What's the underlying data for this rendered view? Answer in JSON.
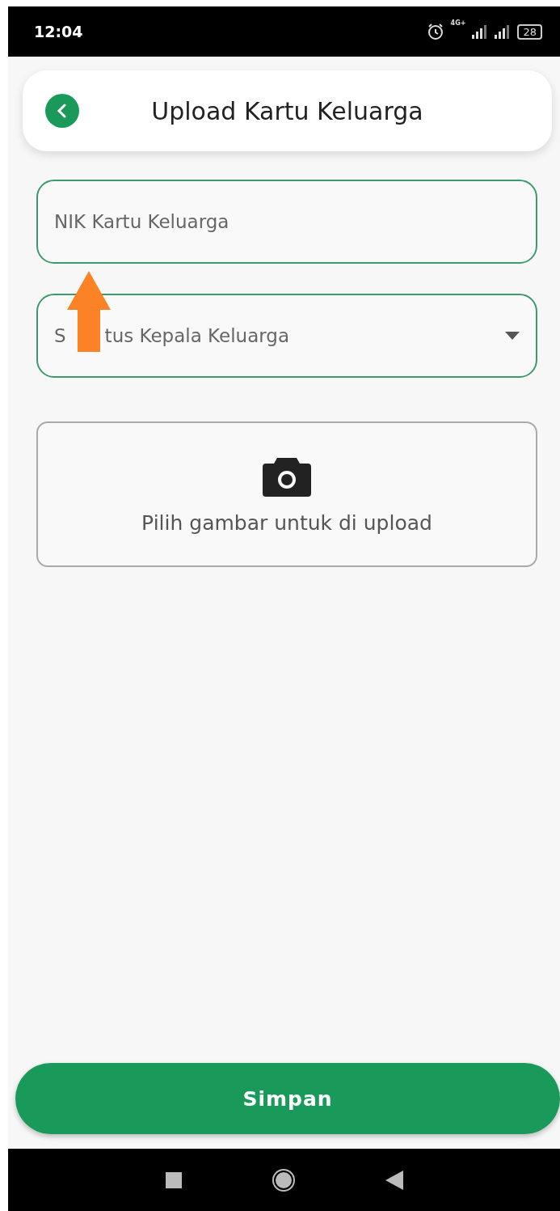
{
  "status_bar": {
    "time": "12:04",
    "network": "4G+",
    "battery": "28"
  },
  "header": {
    "title": "Upload Kartu Keluarga"
  },
  "fields": [
    {
      "kind": "text",
      "placeholder": "NIK Kartu Keluarga"
    },
    {
      "kind": "dropdown",
      "placeholder_start": "S",
      "placeholder_end": "tus Kepala Keluarga"
    }
  ],
  "upload": {
    "label": "Pilih gambar untuk di upload"
  },
  "save_button": "Simpan"
}
